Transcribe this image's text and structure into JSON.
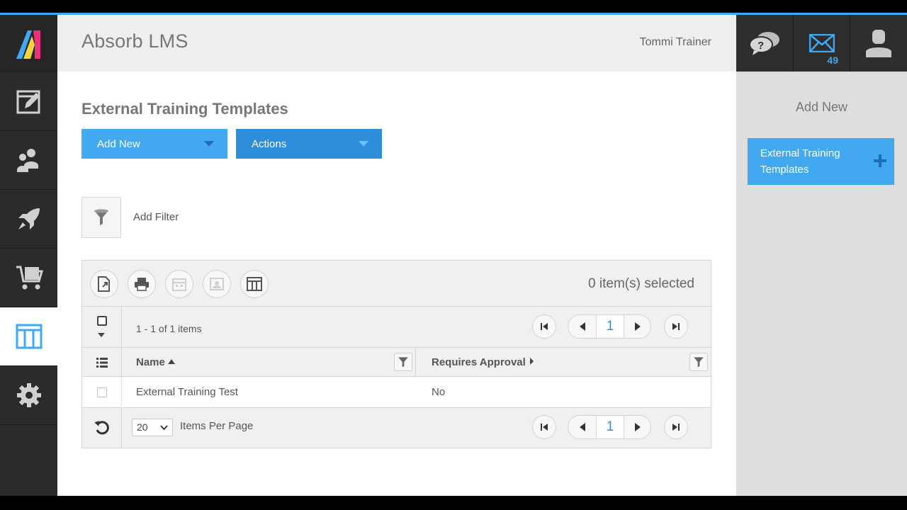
{
  "header": {
    "app_title": "Absorb LMS",
    "user_name": "Tommi Trainer",
    "mail_count": "49"
  },
  "nav": {
    "items": [
      "logo",
      "reports-icon",
      "users-icon",
      "courses-icon",
      "ecommerce-icon",
      "templates-icon",
      "settings-icon"
    ],
    "active": "templates-icon"
  },
  "page": {
    "title": "External Training Templates",
    "add_new_label": "Add New",
    "actions_label": "Actions",
    "add_filter_label": "Add Filter"
  },
  "grid": {
    "selected_text": "0 item(s) selected",
    "range_text": "1 - 1 of 1 items",
    "current_page": "1",
    "columns": [
      {
        "label": "Name",
        "sort": "ascending"
      },
      {
        "label": "Requires Approval"
      }
    ],
    "rows": [
      {
        "name": "External Training Test",
        "requires_approval": "No"
      }
    ],
    "per_page_value": "20",
    "per_page_label": "Items Per Page"
  },
  "right_panel": {
    "title": "Add New",
    "items": [
      {
        "label": "External Training Templates"
      }
    ]
  },
  "colors": {
    "accent": "#3fa9f5",
    "button_primary": "#42a9f0",
    "button_dark": "#2d8fdc",
    "nav_bg": "#2b2b2b"
  }
}
